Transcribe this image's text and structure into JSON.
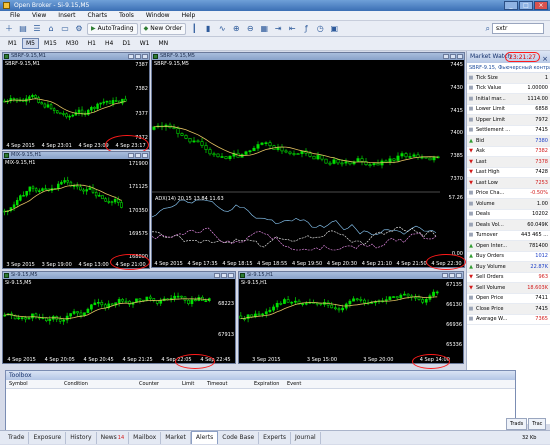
{
  "window": {
    "title": "Open Broker - Si-9.15,M5"
  },
  "menu": [
    "File",
    "View",
    "Insert",
    "Charts",
    "Tools",
    "Window",
    "Help"
  ],
  "toolbar": {
    "autotrading_label": "AutoTrading",
    "new_order_label": "New Order",
    "search_value": "sxtr"
  },
  "timeframes": [
    "M1",
    "M5",
    "M15",
    "M30",
    "H1",
    "H4",
    "D1",
    "W1",
    "MN"
  ],
  "active_timeframe": "M5",
  "charts": {
    "c1": {
      "caption": "SBRF-9.15,M1",
      "symbol_label": "SBRF-9.15,M1",
      "y": [
        "7387",
        "7382",
        "7377",
        "7372"
      ],
      "x": [
        "4 Sep 2015",
        "4 Sep 23:01",
        "4 Sep 23:09",
        "4 Sep 23:17"
      ],
      "last_time": "4 Sep 23:17"
    },
    "c2": {
      "caption": "MIX-9.15,H1",
      "symbol_label": "MIX-9.15,H1",
      "y": [
        "171900",
        "171125",
        "170350",
        "169575",
        "168800"
      ],
      "x": [
        "3 Sep 2015",
        "3 Sep 19:00",
        "4 Sep 13:00",
        "4 Sep 21:00"
      ],
      "last_time": "4 Sep 21:00"
    },
    "c3": {
      "caption": "SBRF-9.15,M5",
      "symbol_label": "SBRF-9.15,M5",
      "y": [
        "7445",
        "7430",
        "7415",
        "7400",
        "7385",
        "7370"
      ],
      "adx": "ADX(14) 20.15 13.84 11.63",
      "adx_levels": [
        "57.26",
        "0.00"
      ],
      "x": [
        "4 Sep 2015",
        "4 Sep 17:35",
        "4 Sep 18:15",
        "4 Sep 18:55",
        "4 Sep 19:50",
        "4 Sep 20:30",
        "4 Sep 21:10",
        "4 Sep 21:50",
        "4 Sep 22:30"
      ],
      "last_time": "4 Sep 22:30"
    },
    "c4": {
      "caption": "Si-9.15,M5",
      "symbol_label": "Si-9.15,M5",
      "y": [
        "68223",
        "67913"
      ],
      "x": [
        "4 Sep 2015",
        "4 Sep 20:05",
        "4 Sep 20:45",
        "4 Sep 21:25",
        "4 Sep 22:05",
        "4 Sep 22:45"
      ],
      "last_time": "4 Sep 22:45"
    },
    "c5": {
      "caption": "Si-9.15,H1",
      "symbol_label": "Si-9.15,H1",
      "y": [
        "67135",
        "66130",
        "66936",
        "65336"
      ],
      "x": [
        "3 Sep 2015",
        "3 Sep 15:00",
        "3 Sep 20:00",
        "4 Sep 14:00"
      ],
      "last_time": "4 Sep 14:00"
    }
  },
  "market_watch": {
    "title": "Market Watch",
    "time": "23:21:27",
    "symbol": "SBRF-9.15, Фьючерсный контракт",
    "rows": [
      {
        "icon": "grey",
        "label": "Tick Size",
        "value": "1"
      },
      {
        "icon": "grey",
        "label": "Tick Value",
        "value": "1.00000"
      },
      {
        "icon": "grey",
        "label": "Initial mar...",
        "value": "1114.00"
      },
      {
        "icon": "grey",
        "label": "Lower Limit",
        "value": "6858"
      },
      {
        "icon": "grey",
        "label": "Upper Limit",
        "value": "7972"
      },
      {
        "icon": "grey",
        "label": "Settlement ...",
        "value": "7415"
      },
      {
        "icon": "green",
        "label": "Bid",
        "value": "7380",
        "color": "blue"
      },
      {
        "icon": "red",
        "label": "Ask",
        "value": "7382",
        "color": "red"
      },
      {
        "icon": "red",
        "label": "Last",
        "value": "7378",
        "color": "red"
      },
      {
        "icon": "red",
        "label": "Last High",
        "value": "7428"
      },
      {
        "icon": "red",
        "label": "Last Low",
        "value": "7253",
        "color": "red"
      },
      {
        "icon": "grey",
        "label": "Price Cha...",
        "value": "-0.50%",
        "color": "red"
      },
      {
        "icon": "grey",
        "label": "Volume",
        "value": "1.00"
      },
      {
        "icon": "grey",
        "label": "Deals",
        "value": "10202"
      },
      {
        "icon": "grey",
        "label": "Deals Vol...",
        "value": "60.049K"
      },
      {
        "icon": "grey",
        "label": "Turnover",
        "value": "443 465 ..."
      },
      {
        "icon": "green",
        "label": "Open Inter...",
        "value": "781400"
      },
      {
        "icon": "green",
        "label": "Buy Orders",
        "value": "1012",
        "color": "blue"
      },
      {
        "icon": "green",
        "label": "Buy Volume",
        "value": "22.87K",
        "color": "blue"
      },
      {
        "icon": "red",
        "label": "Sell Orders",
        "value": "963",
        "color": "red"
      },
      {
        "icon": "red",
        "label": "Sell Volume",
        "value": "18.603K",
        "color": "red"
      },
      {
        "icon": "grey",
        "label": "Open Price",
        "value": "7411"
      },
      {
        "icon": "grey",
        "label": "Close Price",
        "value": "7415"
      },
      {
        "icon": "grey",
        "label": "Average W...",
        "value": "7365",
        "color": "red"
      }
    ]
  },
  "toolbox": {
    "title": "Toolbox",
    "columns": [
      "Symbol",
      "Condition",
      "Counter",
      "Limit",
      "Timeout",
      "Expiration",
      "Event"
    ]
  },
  "tabs": [
    {
      "label": "Trade"
    },
    {
      "label": "Exposure"
    },
    {
      "label": "History"
    },
    {
      "label": "News",
      "badge": "14"
    },
    {
      "label": "Mailbox"
    },
    {
      "label": "Market"
    },
    {
      "label": "Alerts"
    },
    {
      "label": "Code Base"
    },
    {
      "label": "Experts"
    },
    {
      "label": "Journal"
    }
  ],
  "active_tab": "Alerts",
  "side_tabs": [
    "Trads",
    "Trac"
  ],
  "status": "32 Kb"
}
